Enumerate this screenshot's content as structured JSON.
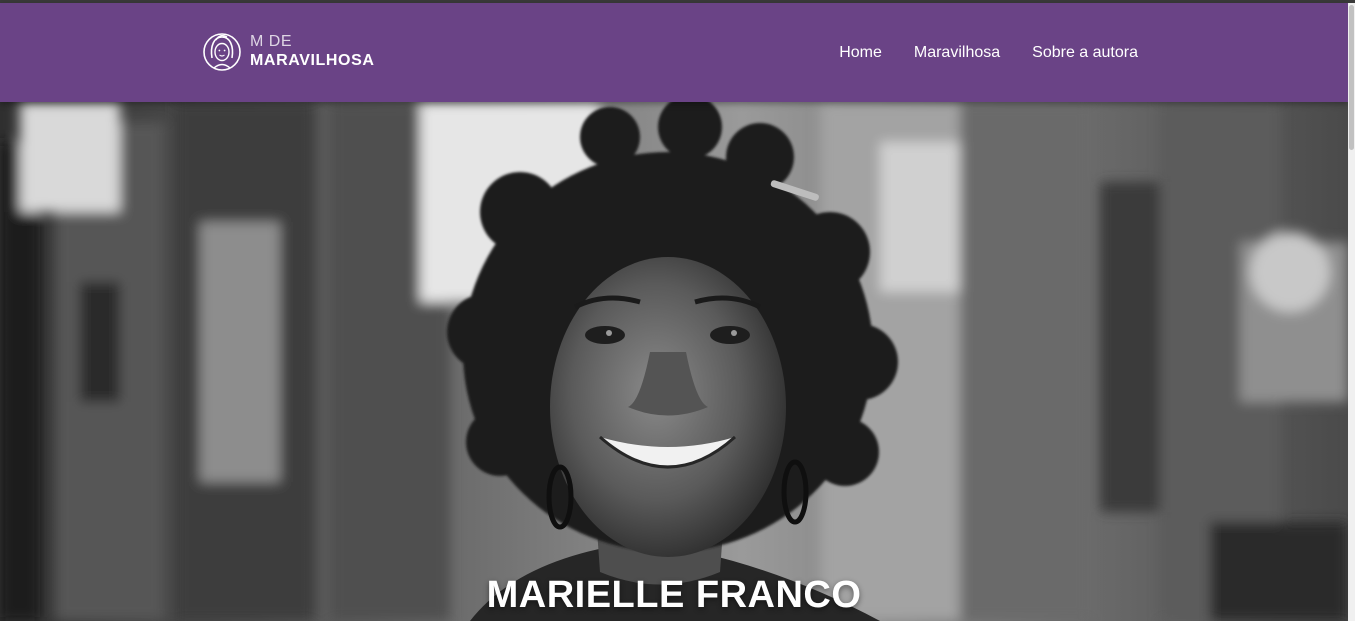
{
  "header": {
    "logo": {
      "line1": "M DE",
      "line2": "MARAVILHOSA",
      "icon": "woman-face-logo-icon"
    },
    "nav": [
      {
        "label": "Home"
      },
      {
        "label": "Maravilhosa"
      },
      {
        "label": "Sobre a autora"
      }
    ]
  },
  "hero": {
    "title": "MARIELLE FRANCO",
    "image": "black-and-white-portrait-photo"
  },
  "colors": {
    "header_bg": "#6a4386",
    "nav_text": "#ffffff",
    "hero_title": "#ffffff"
  }
}
